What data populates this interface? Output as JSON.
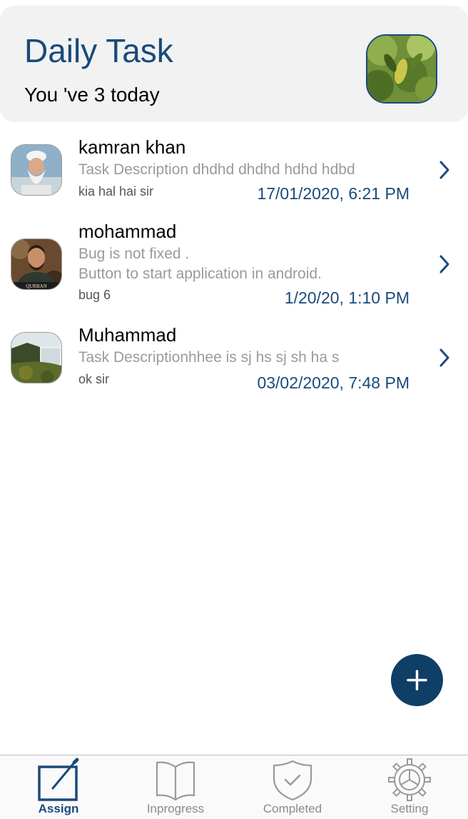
{
  "header": {
    "title": "Daily Task",
    "subtitle": "You 've 3 today"
  },
  "tasks": [
    {
      "name": "kamran khan",
      "description": [
        "Task Description dhdhd dhdhd hdhd hdbd"
      ],
      "note": "kia hal hai sir",
      "date": "17/01/2020, 6:21 PM"
    },
    {
      "name": "mohammad",
      "description": [
        "Bug is not fixed .",
        "Button to start application in android."
      ],
      "note": "bug 6",
      "date": "1/20/20, 1:10 PM",
      "avatar_caption": "QURBAN"
    },
    {
      "name": "Muhammad",
      "description": [
        "Task Descriptionhhee is sj hs sj sh ha s"
      ],
      "note": "ok sir",
      "date": "03/02/2020, 7:48 PM"
    }
  ],
  "fab": {
    "icon": "plus-icon"
  },
  "tabbar": {
    "tabs": [
      {
        "label": "Assign",
        "icon": "edit-icon",
        "active": true
      },
      {
        "label": "Inprogress",
        "icon": "book-icon",
        "active": false
      },
      {
        "label": "Completed",
        "icon": "shield-check-icon",
        "active": false
      },
      {
        "label": "Setting",
        "icon": "gear-icon",
        "active": false
      }
    ]
  },
  "colors": {
    "primary": "#1a4a7a",
    "fab": "#0f3f66",
    "header_bg": "#f2f2f2",
    "muted_text": "#9a9a9a"
  }
}
